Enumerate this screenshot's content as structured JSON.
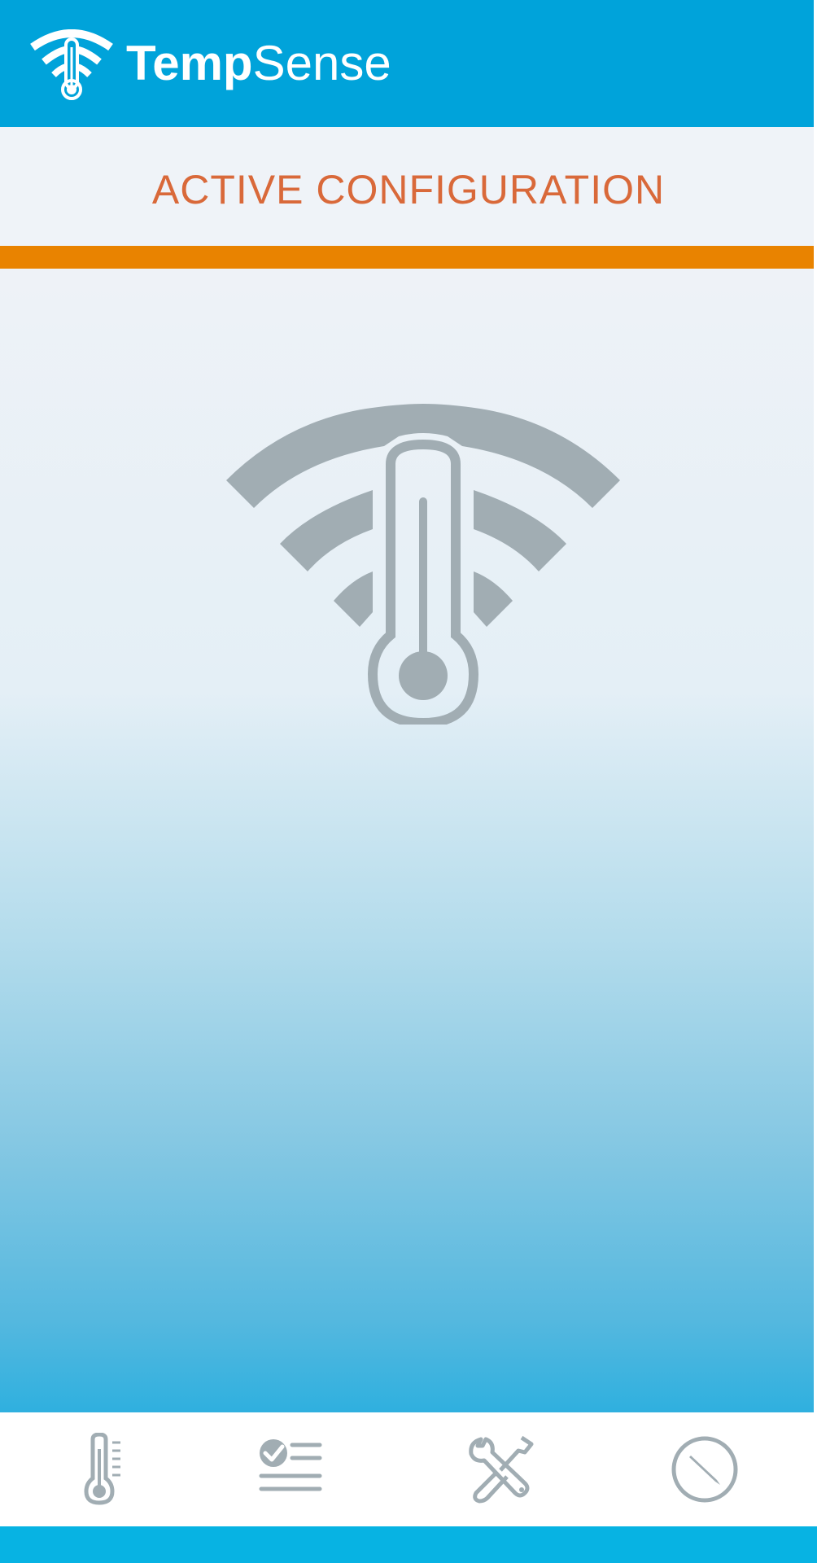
{
  "header": {
    "brand_bold": "Temp",
    "brand_light": "Sense",
    "logo_icon": "wifi-thermometer-icon",
    "background_color": "#00a3da"
  },
  "title": {
    "text": "ACTIVE CONFIGURATION",
    "color": "#d9693a"
  },
  "accent_bar_color": "#e98300",
  "hero_icon": "wifi-thermometer-icon",
  "tabs": [
    {
      "icon": "thermometer-icon"
    },
    {
      "icon": "checklist-icon"
    },
    {
      "icon": "tools-icon"
    },
    {
      "icon": "compass-pencil-icon"
    }
  ]
}
